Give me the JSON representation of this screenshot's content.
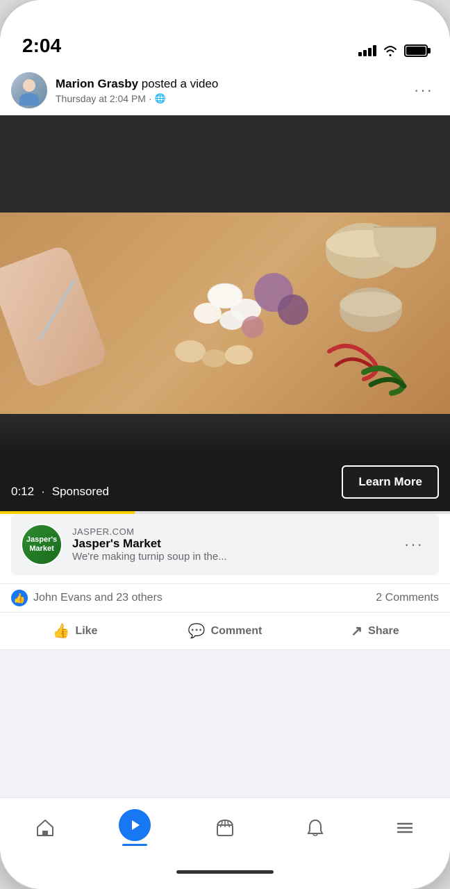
{
  "status_bar": {
    "time": "2:04",
    "signal_label": "signal bars",
    "wifi_label": "wifi",
    "battery_label": "battery"
  },
  "post": {
    "author_name": "Marion Grasby",
    "action_text": "posted a video",
    "timestamp": "Thursday at 2:04 PM",
    "privacy": "Public",
    "more_options_label": "···"
  },
  "video": {
    "timer": "0:12",
    "dot": "·",
    "sponsored_label": "Sponsored",
    "learn_more_label": "Learn More",
    "progress_percent": 30
  },
  "ad": {
    "domain": "JASPER.COM",
    "name": "Jasper's Market",
    "description": "We're making turnip soup in the...",
    "logo_text": "Jasper's\nMarket",
    "more_options_label": "···"
  },
  "reactions": {
    "like_icon": "👍",
    "text": "John Evans and 23 others",
    "comments": "2 Comments"
  },
  "actions": {
    "like_label": "Like",
    "comment_label": "Comment",
    "share_label": "Share"
  },
  "bottom_nav": {
    "home_label": "Home",
    "video_label": "Video",
    "marketplace_label": "Marketplace",
    "notifications_label": "Notifications",
    "menu_label": "Menu"
  }
}
